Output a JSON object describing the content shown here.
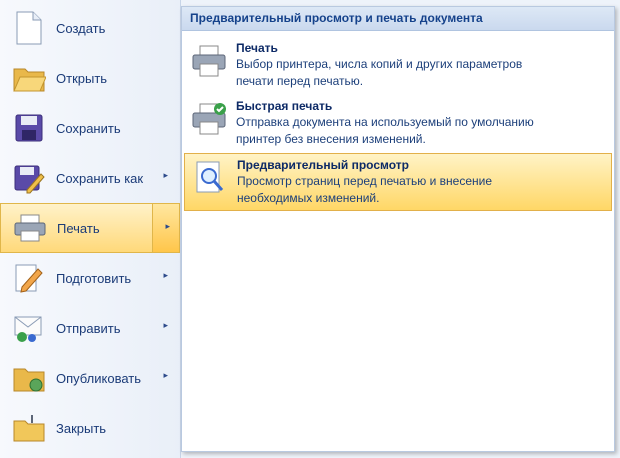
{
  "menu": {
    "items": [
      {
        "label": "Создать",
        "icon": "new-document-icon"
      },
      {
        "label": "Открыть",
        "icon": "open-folder-icon"
      },
      {
        "label": "Сохранить",
        "icon": "save-disk-icon"
      },
      {
        "label": "Сохранить как",
        "icon": "save-as-icon",
        "submenu": true
      },
      {
        "label": "Печать",
        "icon": "printer-icon",
        "submenu": true,
        "active": true
      },
      {
        "label": "Подготовить",
        "icon": "prepare-pencil-icon",
        "submenu": true
      },
      {
        "label": "Отправить",
        "icon": "send-mail-icon",
        "submenu": true
      },
      {
        "label": "Опубликовать",
        "icon": "publish-folder-icon",
        "submenu": true
      },
      {
        "label": "Закрыть",
        "icon": "close-folder-icon"
      }
    ],
    "arrow_glyph": "▸"
  },
  "panel": {
    "header": "Предварительный просмотр и печать документа",
    "options": [
      {
        "title": "Печать",
        "desc1": "Выбор принтера, числа копий и других параметров",
        "desc2": "печати перед печатью.",
        "icon": "printer-icon"
      },
      {
        "title": "Быстрая печать",
        "desc1": "Отправка документа на используемый по умолчанию",
        "desc2": "принтер без внесения изменений.",
        "icon": "quick-print-icon"
      },
      {
        "title": "Предварительный просмотр",
        "desc1": "Просмотр страниц перед печатью и внесение",
        "desc2": "необходимых изменений.",
        "icon": "print-preview-icon",
        "highlighted": true
      }
    ]
  },
  "colors": {
    "highlight": "#ffd766",
    "panel_header": "#cad9ee",
    "text": "#15428b"
  }
}
